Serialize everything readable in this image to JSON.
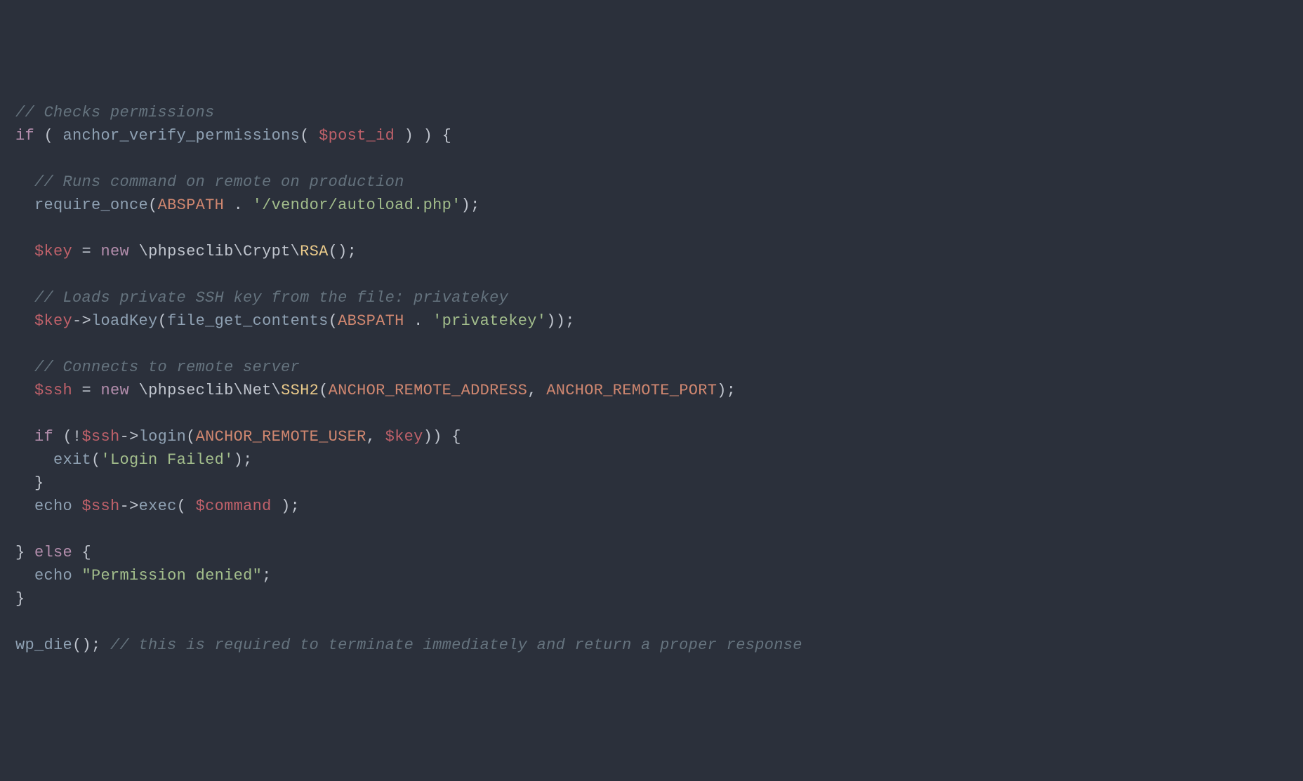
{
  "code": {
    "c1": "// Checks permissions",
    "l2_1": "if",
    "l2_2": " ( ",
    "l2_3": "anchor_verify_permissions",
    "l2_4": "( ",
    "l2_5": "$post_id",
    "l2_6": " ) ) {",
    "c3": "  // Runs command on remote on production",
    "l4_1": "  ",
    "l4_2": "require_once",
    "l4_3": "(",
    "l4_4": "ABSPATH",
    "l4_5": " . ",
    "l4_6": "'/vendor/autoload.php'",
    "l4_7": ");",
    "l5_1": "  ",
    "l5_2": "$key",
    "l5_3": " = ",
    "l5_4": "new",
    "l5_5": " \\phpseclib\\Crypt\\",
    "l5_6": "RSA",
    "l5_7": "();",
    "c6": "  // Loads private SSH key from the file: privatekey",
    "l7_1": "  ",
    "l7_2": "$key",
    "l7_3": "->",
    "l7_4": "loadKey",
    "l7_5": "(",
    "l7_6": "file_get_contents",
    "l7_7": "(",
    "l7_8": "ABSPATH",
    "l7_9": " . ",
    "l7_10": "'privatekey'",
    "l7_11": "));",
    "c8": "  // Connects to remote server",
    "l9_1": "  ",
    "l9_2": "$ssh",
    "l9_3": " = ",
    "l9_4": "new",
    "l9_5": " \\phpseclib\\Net\\",
    "l9_6": "SSH2",
    "l9_7": "(",
    "l9_8": "ANCHOR_REMOTE_ADDRESS",
    "l9_9": ", ",
    "l9_10": "ANCHOR_REMOTE_PORT",
    "l9_11": ");",
    "l10_1": "  ",
    "l10_2": "if",
    "l10_3": " (!",
    "l10_4": "$ssh",
    "l10_5": "->",
    "l10_6": "login",
    "l10_7": "(",
    "l10_8": "ANCHOR_REMOTE_USER",
    "l10_9": ", ",
    "l10_10": "$key",
    "l10_11": ")) {",
    "l11_1": "    ",
    "l11_2": "exit",
    "l11_3": "(",
    "l11_4": "'Login Failed'",
    "l11_5": ");",
    "l12_1": "  }",
    "l13_1": "  ",
    "l13_2": "echo",
    "l13_3": " ",
    "l13_4": "$ssh",
    "l13_5": "->",
    "l13_6": "exec",
    "l13_7": "( ",
    "l13_8": "$command",
    "l13_9": " );",
    "l14_1": "} ",
    "l14_2": "else",
    "l14_3": " {",
    "l15_1": "  ",
    "l15_2": "echo",
    "l15_3": " ",
    "l15_4": "\"Permission denied\"",
    "l15_5": ";",
    "l16_1": "}",
    "l17_1": "wp_die",
    "l17_2": "();",
    "l17_3": " ",
    "c17": "// this is required to terminate immediately and return a proper response"
  }
}
